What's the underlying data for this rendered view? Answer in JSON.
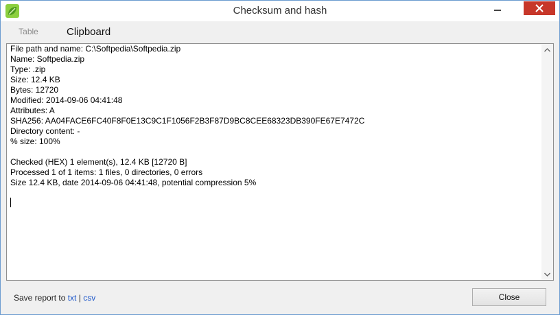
{
  "window": {
    "title": "Checksum and hash",
    "app_icon": "leaf-icon"
  },
  "titlebar_buttons": {
    "minimize_icon": "minimize-icon",
    "close_icon": "close-icon"
  },
  "tabs": [
    {
      "label": "Table",
      "state": "inactive"
    },
    {
      "label": "Clipboard",
      "state": "active"
    }
  ],
  "report": {
    "lines": [
      "File path and name: C:\\Softpedia\\Softpedia.zip",
      "Name: Softpedia.zip",
      "Type: .zip",
      "Size: 12.4 KB",
      "Bytes: 12720",
      "Modified: 2014-09-06 04:41:48",
      "Attributes: A",
      "SHA256: AA04FACE6FC40F8F0E13C9C1F1056F2B3F87D9BC8CEE68323DB390FE67E7472C",
      "Directory content: -",
      "% size: 100%",
      "",
      "Checked (HEX) 1 element(s), 12.4 KB [12720 B]",
      "Processed 1 of 1 items: 1 files, 0 directories, 0 errors",
      "Size 12.4 KB, date 2014-09-06 04:41:48, potential compression 5%"
    ]
  },
  "footer": {
    "save_prefix": "Save report to ",
    "txt_link": "txt",
    "separator": " | ",
    "csv_link": "csv",
    "close_label": "Close"
  },
  "colors": {
    "link": "#1a55c9",
    "close_button_hover": "#c7372a",
    "window_border": "#6a9bcf"
  }
}
